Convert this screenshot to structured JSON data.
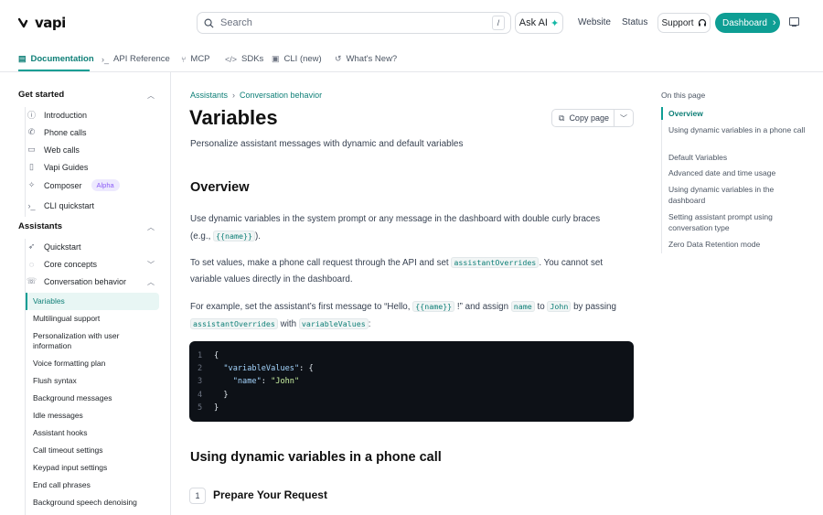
{
  "header": {
    "logo": "vapi",
    "search_placeholder": "Search",
    "search_shortcut": "/",
    "ask_ai": "Ask AI",
    "website": "Website",
    "status": "Status",
    "support": "Support",
    "dashboard": "Dashboard"
  },
  "tabs": [
    {
      "label": "Documentation",
      "icon": "book-icon"
    },
    {
      "label": "API Reference",
      "icon": "terminal-icon"
    },
    {
      "label": "MCP",
      "icon": "branch-icon"
    },
    {
      "label": "SDKs",
      "icon": "code-icon"
    },
    {
      "label": "CLI (new)",
      "icon": "cli-icon"
    },
    {
      "label": "What's New?",
      "icon": "history-icon"
    }
  ],
  "sidebar": {
    "get_started_title": "Get started",
    "get_started_items": [
      {
        "label": "Introduction",
        "icon": "info-icon"
      },
      {
        "label": "Phone calls",
        "icon": "phone-icon"
      },
      {
        "label": "Web calls",
        "icon": "browser-icon"
      },
      {
        "label": "Vapi Guides",
        "icon": "book-open-icon"
      },
      {
        "label": "Composer",
        "icon": "wand-icon",
        "badge": "Alpha"
      },
      {
        "label": "CLI quickstart",
        "icon": "terminal-icon"
      }
    ],
    "assistants_title": "Assistants",
    "assistants_items": [
      {
        "label": "Quickstart",
        "icon": "rocket-icon"
      },
      {
        "label": "Core concepts",
        "icon": "circle-icon"
      },
      {
        "label": "Conversation behavior",
        "icon": "chat-icon"
      }
    ],
    "conversation_items": [
      "Variables",
      "Multilingual support",
      "Personalization with user information",
      "Voice formatting plan",
      "Flush syntax",
      "Background messages",
      "Idle messages",
      "Assistant hooks",
      "Call timeout settings",
      "Keypad input settings",
      "End call phrases",
      "Background speech denoising"
    ]
  },
  "main": {
    "breadcrumb": [
      "Assistants",
      "Conversation behavior"
    ],
    "title": "Variables",
    "copy_page": "Copy page",
    "subtitle": "Personalize assistant messages with dynamic and default variables",
    "overview_heading": "Overview",
    "p1_a": "Use dynamic variables in the system prompt or any message in the dashboard with double curly braces",
    "p1_b": "(e.g.,",
    "p1_code": "{{name}}",
    "p1_c": ").",
    "p2_a": "To set values, make a phone call request through the API and set",
    "p2_code": "assistantOverrides",
    "p2_b": ". You cannot set",
    "p2_c": "variable values directly in the dashboard.",
    "p3_a": "For example, set the assistant’s first message to “Hello,",
    "p3_code1": "{{name}}",
    "p3_b": "!” and assign",
    "p3_code2": "name",
    "p3_c": "to",
    "p3_code3": "John",
    "p3_d": "by passing",
    "p3_code4": "assistantOverrides",
    "p3_e": "with",
    "p3_code5": "variableValues",
    "p3_f": ":",
    "code_lines": [
      "1",
      "2",
      "3",
      "4",
      "5"
    ],
    "code_open": "{",
    "code_key1": "\"variableValues\"",
    "code_colon1": ": {",
    "code_key2": "\"name\"",
    "code_colon2": ": ",
    "code_val": "\"John\"",
    "code_close_inner": "}",
    "code_close": "}",
    "phone_heading": "Using dynamic variables in a phone call",
    "step_number": "1",
    "step_title": "Prepare Your Request"
  },
  "toc": {
    "title": "On this page",
    "items": [
      "Overview",
      "Using dynamic variables in a phone call",
      "Default Variables",
      "Advanced date and time usage",
      "Using dynamic variables in the dashboard",
      "Setting assistant prompt using conversation type",
      "Zero Data Retention mode"
    ]
  },
  "colors": {
    "accent": "#0e9e94",
    "accent_text": "#0e7f77",
    "code_bg": "#0d1117",
    "badge_bg": "#ede9fe",
    "badge_text": "#8b5cf6"
  }
}
